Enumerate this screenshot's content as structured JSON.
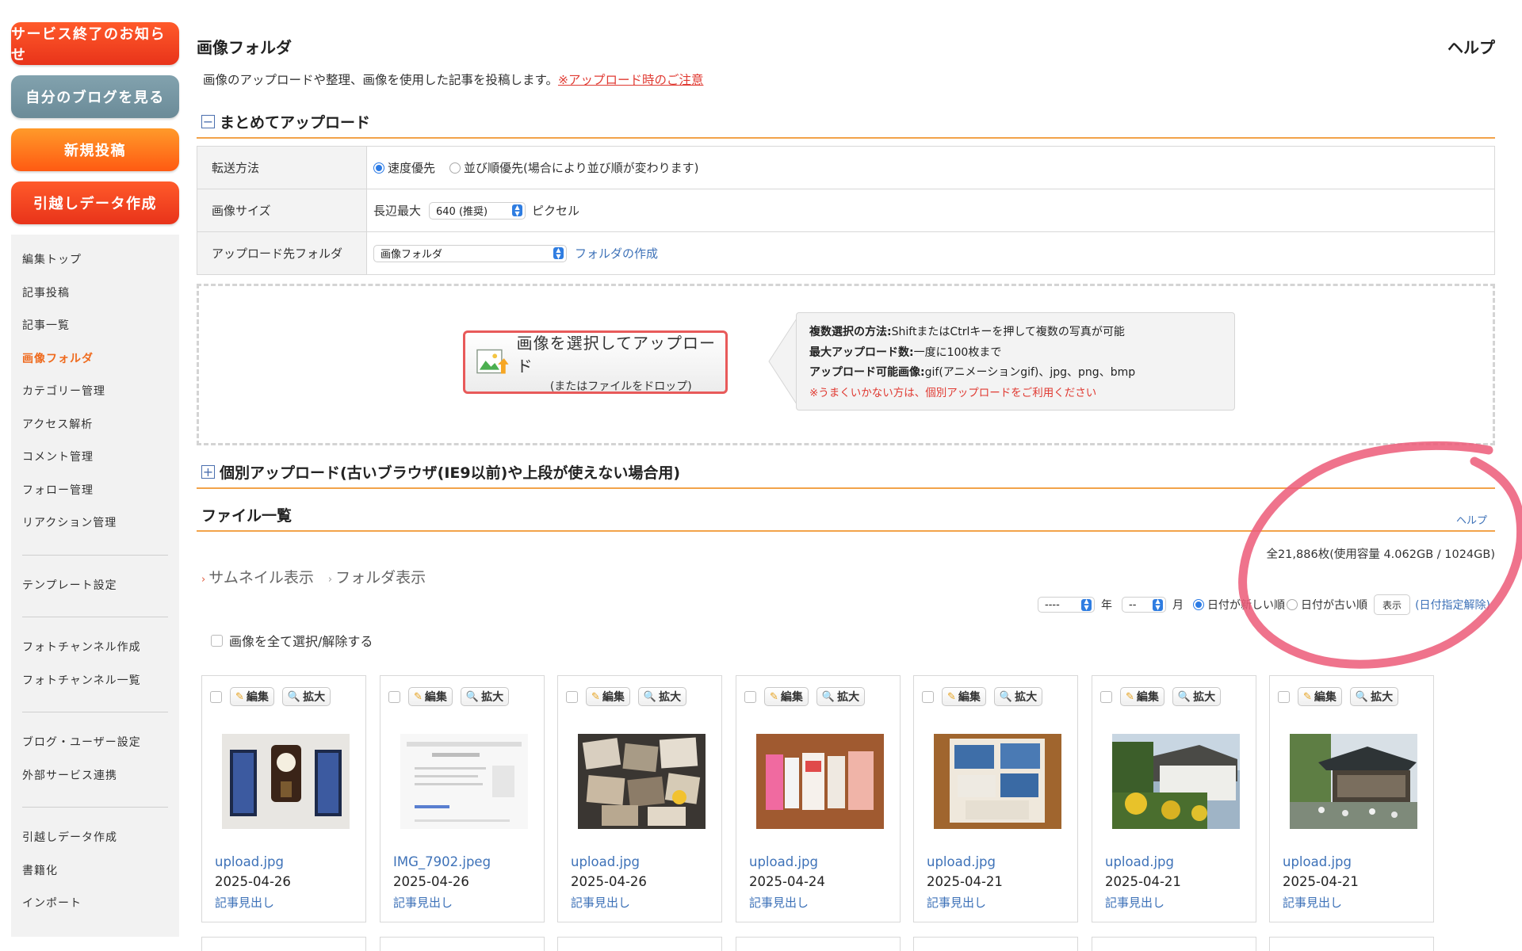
{
  "sidebar": {
    "buttons": [
      {
        "label": "サービス終了のお知らせ"
      },
      {
        "label": "自分のブログを見る"
      },
      {
        "label": "新規投稿"
      },
      {
        "label": "引越しデータ作成"
      }
    ],
    "menu": [
      {
        "label": "編集トップ"
      },
      {
        "label": "記事投稿"
      },
      {
        "label": "記事一覧"
      },
      {
        "label": "画像フォルダ"
      },
      {
        "label": "カテゴリー管理"
      },
      {
        "label": "アクセス解析"
      },
      {
        "label": "コメント管理"
      },
      {
        "label": "フォロー管理"
      },
      {
        "label": "リアクション管理"
      },
      {
        "label": "テンプレート設定"
      },
      {
        "label": "フォトチャンネル作成"
      },
      {
        "label": "フォトチャンネル一覧"
      },
      {
        "label": "ブログ・ユーザー設定"
      },
      {
        "label": "外部サービス連携"
      },
      {
        "label": "引越しデータ作成"
      },
      {
        "label": "書籍化"
      },
      {
        "label": "インポート"
      }
    ],
    "active_color": "#ef6a1d"
  },
  "header": {
    "title": "画像フォルダ",
    "help": "ヘルプ",
    "description": "画像のアップロードや整理、画像を使用した記事を投稿します。",
    "notice_link": "※アップロード時のご注意"
  },
  "bulk_upload": {
    "toggle": "−",
    "title": "まとめてアップロード",
    "rows": {
      "transfer": {
        "label": "転送方法",
        "option_speed": "速度優先",
        "option_order": "並び順優先(場合により並び順が変わります)"
      },
      "size": {
        "label": "画像サイズ",
        "prefix": "長辺最大",
        "selected": "640 (推奨)",
        "suffix": "ピクセル"
      },
      "folder": {
        "label": "アップロード先フォルダ",
        "selected": "画像フォルダ",
        "create_link": "フォルダの作成"
      }
    },
    "upload_button": {
      "line1": "画像を選択してアップロード",
      "line2": "(またはファイルをドロップ)"
    },
    "info": {
      "multi_label": "複数選択の方法:",
      "multi_text": "ShiftまたはCtrlキーを押して複数の写真が可能",
      "max_label": "最大アップロード数:",
      "max_text": "一度に100枚まで",
      "types_label": "アップロード可能画像:",
      "types_text": "gif(アニメーションgif)、jpg、png、bmp",
      "warning": "※うまくいかない方は、個別アップロードをご利用ください"
    }
  },
  "single_upload": {
    "toggle": "+",
    "title": "個別アップロード(古いブラウザ(IE9以前)や上段が使えない場合用)"
  },
  "file_list": {
    "title": "ファイル一覧",
    "help": "ヘルプ",
    "usage": "全21,886枚(使用容量  4.062GB / 1024GB)",
    "view_thumbnail": "サムネイル表示",
    "view_folder": "フォルダ表示",
    "filter": {
      "year_value": "----",
      "year_label": "年",
      "month_value": "--",
      "month_label": "月",
      "sort_new": "日付が新しい順",
      "sort_old": "日付が古い順",
      "show_button": "表示",
      "clear_link": "(日付指定解除)"
    },
    "select_all": "画像を全て選択/解除する",
    "edit_label": "編集",
    "zoom_label": "拡大",
    "items": [
      {
        "name": "upload.jpg",
        "date": "2025-04-26",
        "headline": "記事見出し",
        "thumb": "clock-wall"
      },
      {
        "name": "IMG_7902.jpeg",
        "date": "2025-04-26",
        "headline": "記事見出し",
        "thumb": "screenshot"
      },
      {
        "name": "upload.jpg",
        "date": "2025-04-26",
        "headline": "記事見出し",
        "thumb": "photo-collage"
      },
      {
        "name": "upload.jpg",
        "date": "2025-04-24",
        "headline": "記事見出し",
        "thumb": "packages"
      },
      {
        "name": "upload.jpg",
        "date": "2025-04-21",
        "headline": "記事見出し",
        "thumb": "blue-bags"
      },
      {
        "name": "upload.jpg",
        "date": "2025-04-21",
        "headline": "記事見出し",
        "thumb": "garden-house"
      },
      {
        "name": "upload.jpg",
        "date": "2025-04-21",
        "headline": "記事見出し",
        "thumb": "temple"
      }
    ]
  },
  "colors": {
    "accent_orange": "#f2a34a",
    "link_blue": "#3e72b8",
    "warning_red": "#e03a32",
    "annotation_pink": "#ec5a78"
  }
}
